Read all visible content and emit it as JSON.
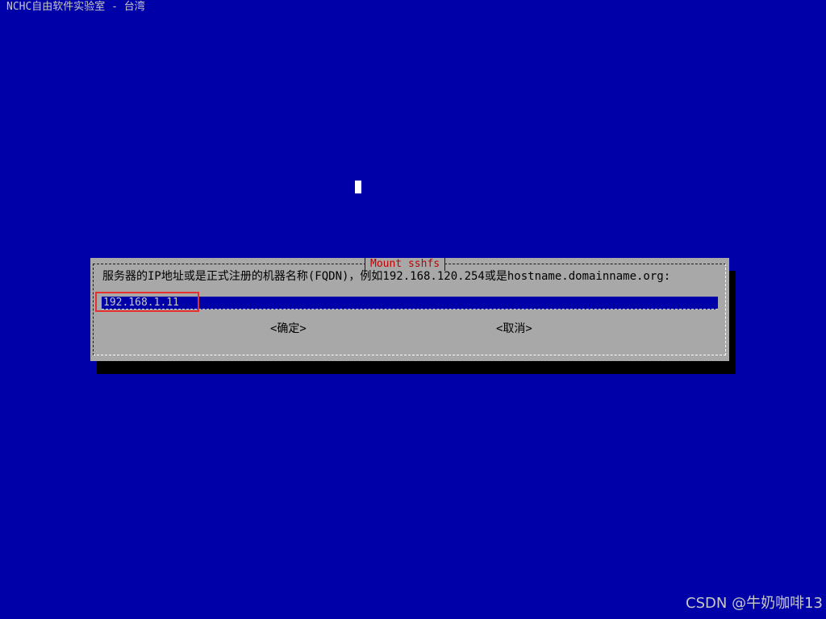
{
  "backtitle": "NCHC自由软件实验室 - 台湾",
  "dialog": {
    "title": "Mount sshfs",
    "prompt": "服务器的IP地址或是正式注册的机器名称(FQDN)，例如192.168.120.254或是hostname.domainname.org:",
    "input_value": "192.168.1.11",
    "ok_label": "<确定>",
    "cancel_label": "<取消>"
  },
  "watermark": "CSDN @牛奶咖啡13",
  "colors": {
    "background": "#0000a8",
    "dialog": "#a8a8a8",
    "title": "#c00000",
    "highlight": "#e53030"
  }
}
